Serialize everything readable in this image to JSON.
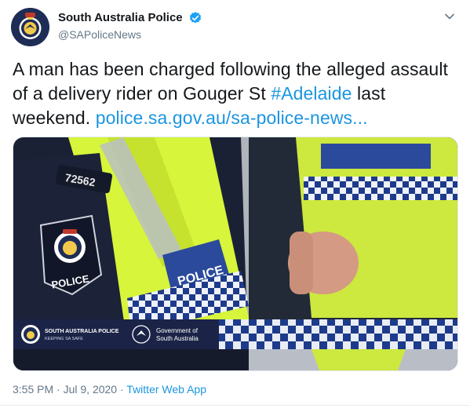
{
  "author": {
    "name": "South Australia Police",
    "handle": "@SAPoliceNews"
  },
  "tweet": {
    "text_part1": "A man has been charged following the alleged assault of a delivery rider on Gouger St ",
    "hashtag": "#Adelaide",
    "text_part2": " last weekend. ",
    "link": "police.sa.gov.au/sa-police-news..."
  },
  "media": {
    "badge_number": "72562",
    "vest_label": "POLICE",
    "patch_label": "POLICE",
    "banner": {
      "org_line1": "SOUTH AUSTRALIA POLICE",
      "org_line2": "KEEPING SA SAFE",
      "gov_line1": "Government of",
      "gov_line2": "South Australia"
    }
  },
  "meta": {
    "time": "3:55 PM",
    "separator1": " · ",
    "date": "Jul 9, 2020",
    "separator2": " · ",
    "source": "Twitter Web App"
  },
  "colors": {
    "link": "#1b95e0",
    "verified": "#1da1f2",
    "police_blue": "#1e2d55",
    "hi_vis": "#d7f53a"
  },
  "icons": [
    "verified-badge-icon",
    "chevron-down-icon",
    "sa-police-crest-icon",
    "piping-shrike-icon"
  ]
}
